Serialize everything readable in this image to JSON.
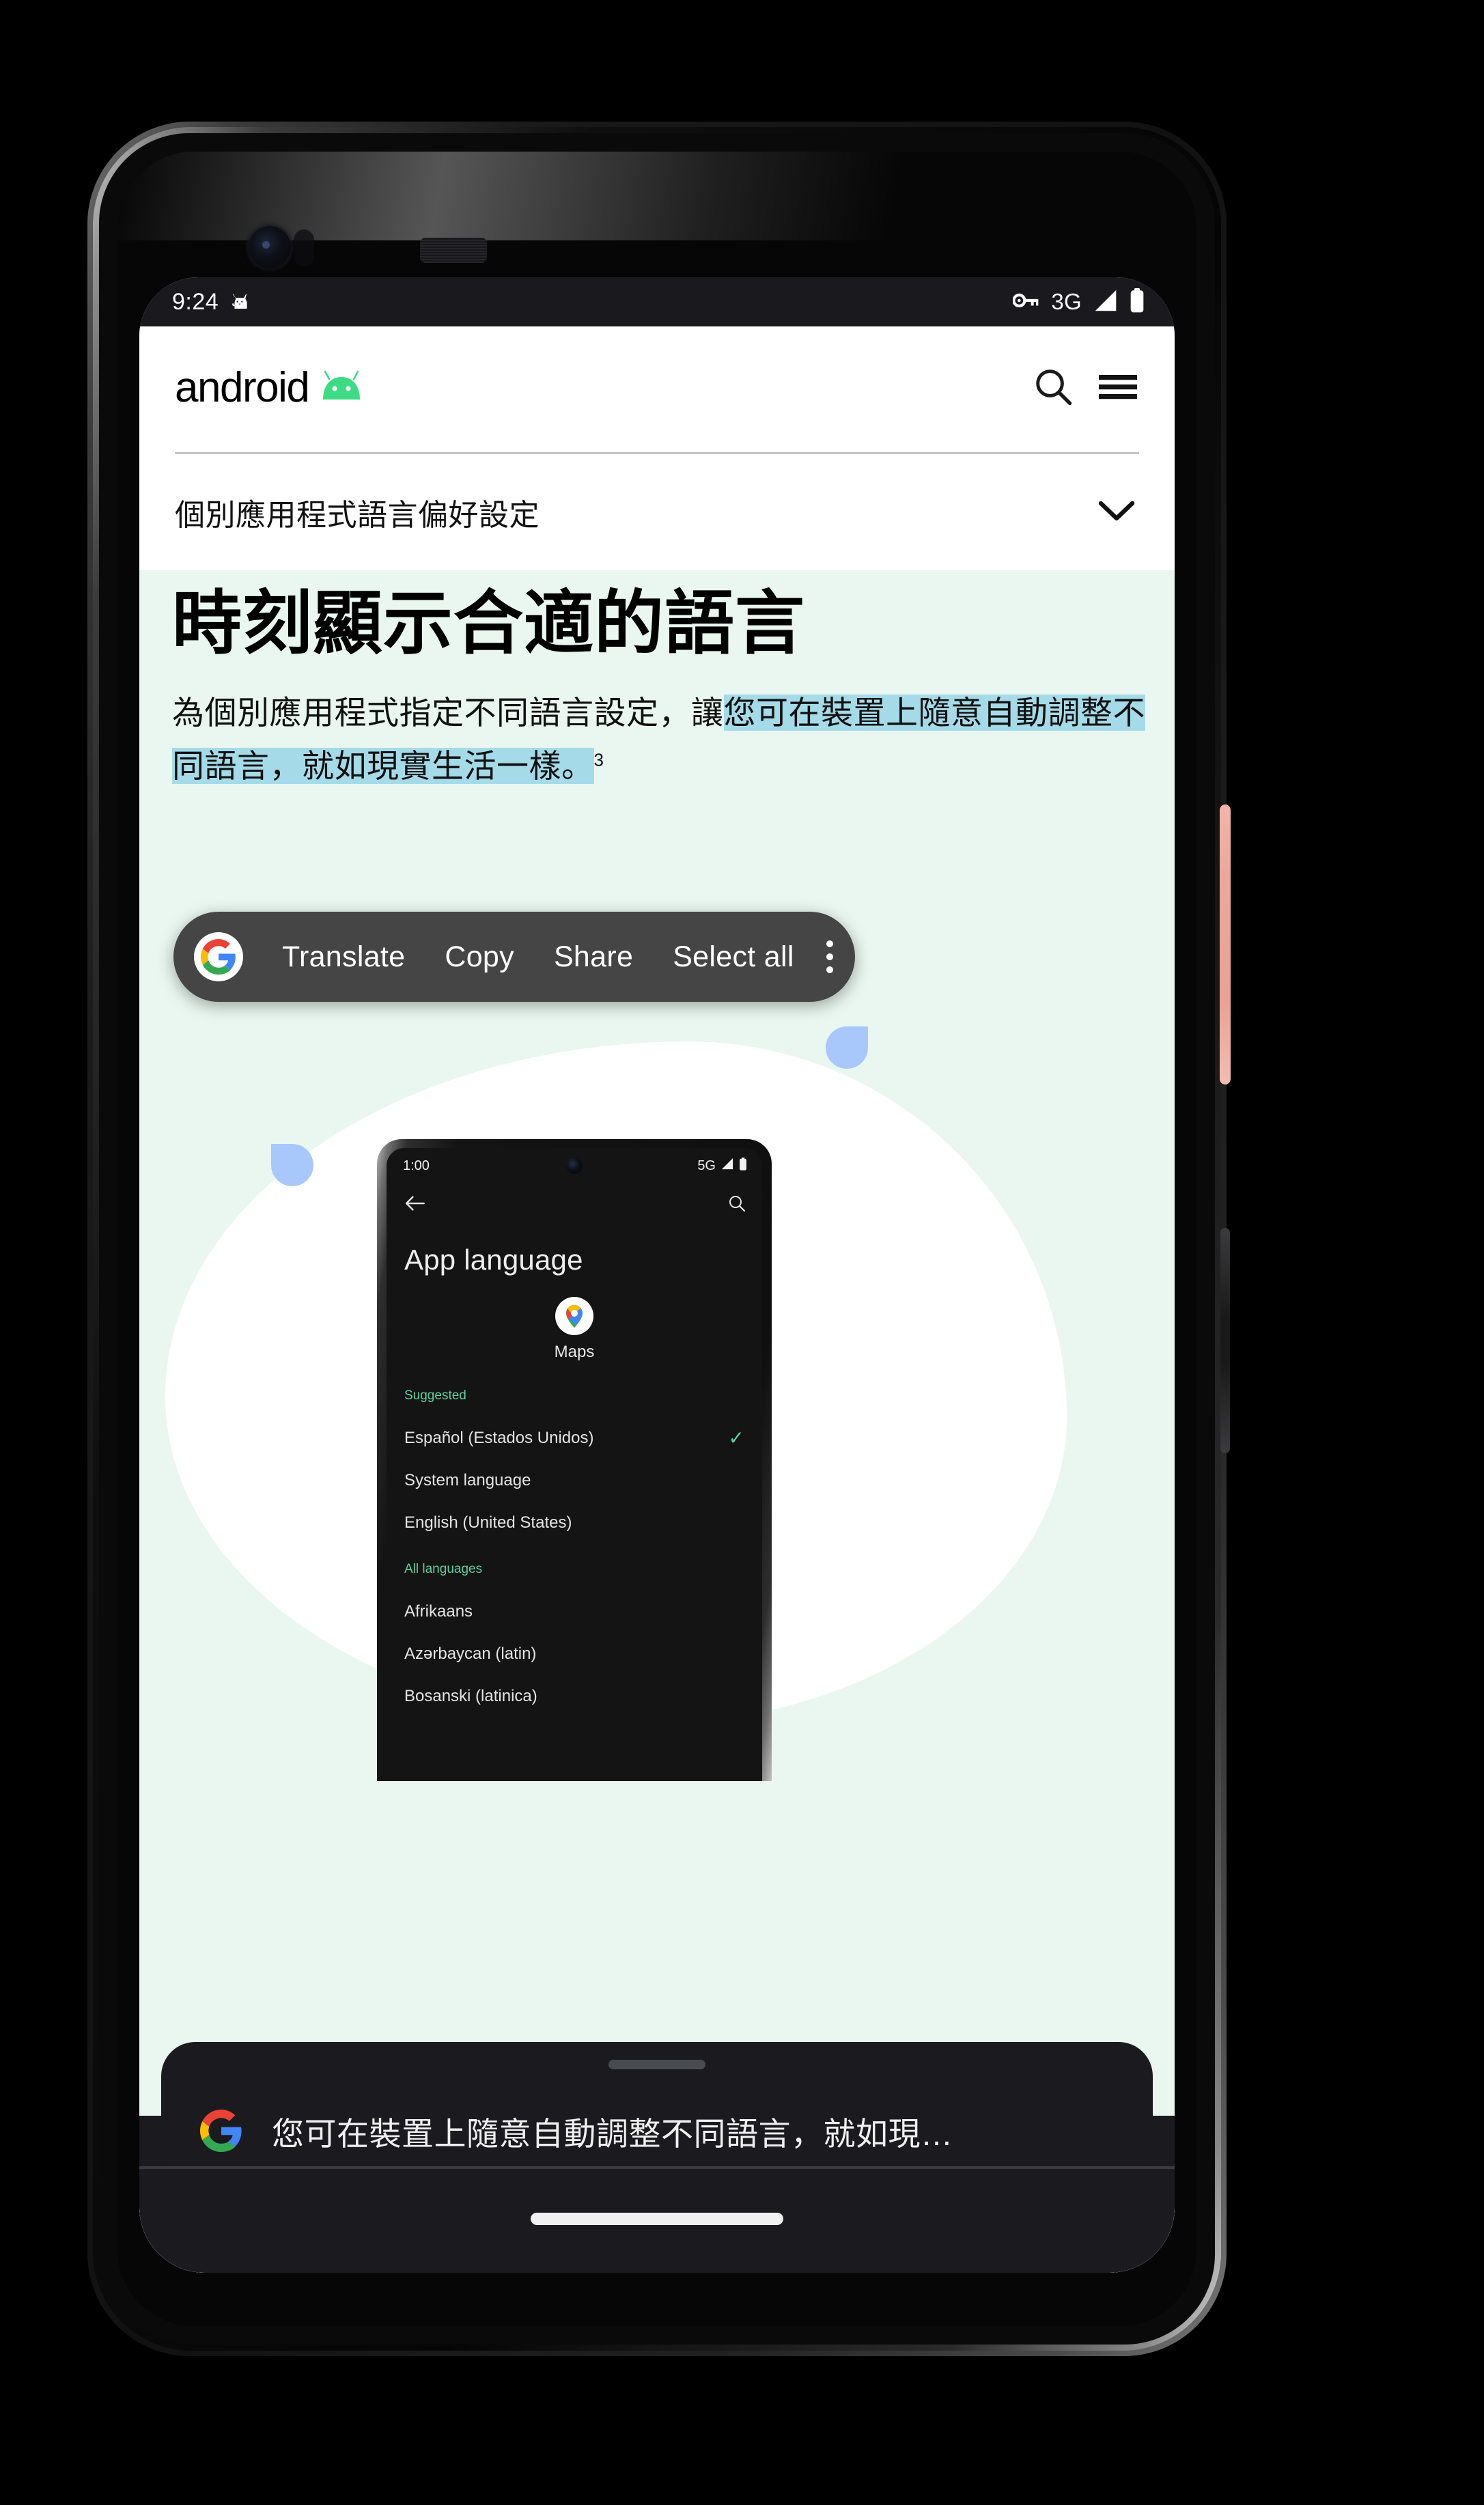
{
  "device": {
    "status_bar": {
      "time": "9:24",
      "cat_icon": "cat-icon",
      "vpn_key_icon": "key-icon",
      "network": "3G",
      "signal_icon": "signal-icon",
      "battery_icon": "battery-icon"
    }
  },
  "web_header": {
    "brand_word": "android",
    "brand_icon": "android-robot-icon",
    "search_icon": "search-icon",
    "menu_icon": "hamburger-menu-icon"
  },
  "accordion": {
    "label": "個別應用程式語言偏好設定",
    "chevron_icon": "chevron-down-icon"
  },
  "hero": {
    "title": "時刻顯示合適的語言",
    "body_part1": "為個別應用程式指定不同語言設定，讓",
    "body_selected": "您可在裝置上隨意自動調整不同語言，就如現實生活一樣。",
    "footnote": "3"
  },
  "selection_toolbar": {
    "google_icon": "google-g-icon",
    "items": [
      {
        "label": "Translate"
      },
      {
        "label": "Copy"
      },
      {
        "label": "Share"
      },
      {
        "label": "Select all"
      }
    ],
    "overflow_icon": "more-vertical-icon"
  },
  "phone_mockup": {
    "status_bar": {
      "time": "1:00",
      "network": "5G",
      "signal_icon": "signal-icon",
      "battery_icon": "battery-icon"
    },
    "back_icon": "arrow-back-icon",
    "search_icon": "search-icon",
    "title": "App language",
    "app_icon": "google-maps-pin-icon",
    "app_name": "Maps",
    "sections": [
      {
        "heading": "Suggested",
        "rows": [
          {
            "label": "Español (Estados Unidos)",
            "checked": "✓"
          },
          {
            "label": "System language",
            "checked": ""
          },
          {
            "label": "English (United States)",
            "checked": ""
          }
        ]
      },
      {
        "heading": "All languages",
        "rows": [
          {
            "label": "Afrikaans",
            "checked": ""
          },
          {
            "label": "Azərbaycan (latin)",
            "checked": ""
          },
          {
            "label": "Bosanski (latinica)",
            "checked": ""
          }
        ]
      }
    ]
  },
  "translate_bar": {
    "google_icon": "google-g-icon",
    "text": "您可在裝置上隨意自動調整不同語言，就如現…"
  },
  "colors": {
    "hero_background": "#e9f7f0",
    "selection_highlight": "#a5dbe8",
    "selection_handle": "#a8c7fa",
    "android_green": "#3ddc84",
    "mock_accent_green": "#5fd1a0",
    "toolbar_background": "#454545",
    "translate_bar_background": "#1b1b1f",
    "power_button": "#eba89a"
  }
}
